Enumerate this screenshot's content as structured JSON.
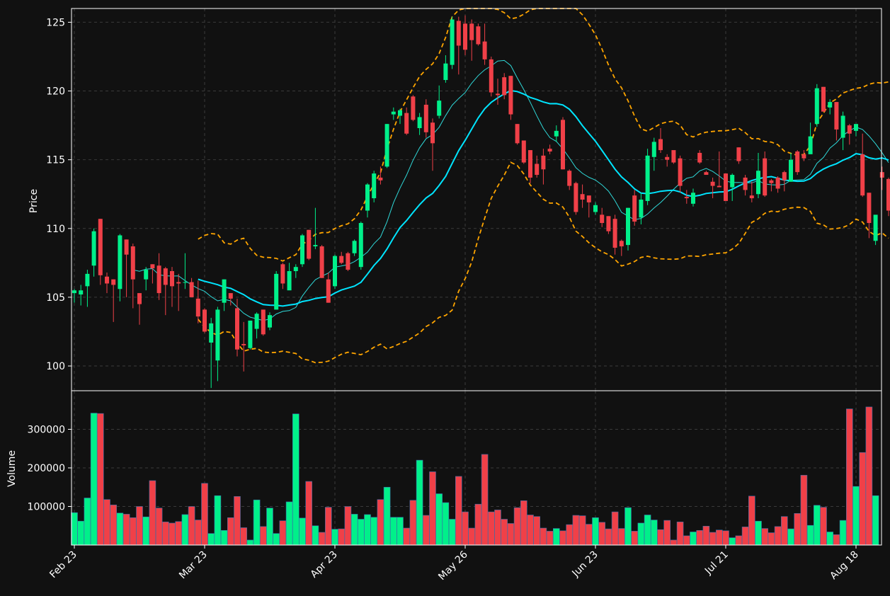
{
  "chart_data": [
    {
      "type": "candlestick",
      "ylabel": "Price",
      "ylim": [
        98.2,
        126.0
      ],
      "yticks": [
        "100",
        "105",
        "110",
        "115",
        "120",
        "125"
      ],
      "ytick_values": [
        100,
        105,
        110,
        115,
        120,
        125
      ],
      "xticks": [
        "Feb 23",
        "Mar 23",
        "Apr 23",
        "May 26",
        "Jun 23",
        "Jul 21",
        "Aug 18"
      ],
      "xtick_index": [
        0,
        20,
        40,
        60,
        80,
        100,
        120
      ],
      "colors": {
        "up": "#00f08a",
        "down": "#f04048",
        "ma_short": "#2fd8d8",
        "ma_long": "#00e5ff",
        "bands": "#ffa500"
      },
      "grid": true,
      "ohlc": [
        [
          105.3,
          105.6,
          104.6,
          105.5
        ],
        [
          105.2,
          105.9,
          104.4,
          105.5
        ],
        [
          105.8,
          107.0,
          104.3,
          106.7
        ],
        [
          107.3,
          110.0,
          106.5,
          109.8
        ],
        [
          110.7,
          110.7,
          105.9,
          106.6
        ],
        [
          106.5,
          106.8,
          105.3,
          106.0
        ],
        [
          106.3,
          106.3,
          103.2,
          105.9
        ],
        [
          105.6,
          109.6,
          104.7,
          109.5
        ],
        [
          109.2,
          109.2,
          105.0,
          108.1
        ],
        [
          108.7,
          108.9,
          104.2,
          106.3
        ],
        [
          105.3,
          105.3,
          103.0,
          104.5
        ],
        [
          106.3,
          107.2,
          105.5,
          107.0
        ],
        [
          107.4,
          107.4,
          106.0,
          107.1
        ],
        [
          107.3,
          108.2,
          104.8,
          105.3
        ],
        [
          107.1,
          107.2,
          103.7,
          105.9
        ],
        [
          106.9,
          107.2,
          104.3,
          105.8
        ],
        [
          106.1,
          106.7,
          104.0,
          106.0
        ],
        [
          106.1,
          108.2,
          105.6,
          106.1
        ],
        [
          106.1,
          106.4,
          105.2,
          105.0
        ],
        [
          104.9,
          106.2,
          103.1,
          103.6
        ],
        [
          104.1,
          104.2,
          102.4,
          102.5
        ],
        [
          101.7,
          103.5,
          98.4,
          103.1
        ],
        [
          100.4,
          104.3,
          98.9,
          104.1
        ],
        [
          104.6,
          106.3,
          104.0,
          106.3
        ],
        [
          105.3,
          105.3,
          104.4,
          104.9
        ],
        [
          104.2,
          104.9,
          100.7,
          101.2
        ],
        [
          101.6,
          103.2,
          99.6,
          101.5
        ],
        [
          101.3,
          103.3,
          101.2,
          103.3
        ],
        [
          102.7,
          103.9,
          102.0,
          103.8
        ],
        [
          104.1,
          104.1,
          102.2,
          102.3
        ],
        [
          102.8,
          103.9,
          102.6,
          103.7
        ],
        [
          104.1,
          106.9,
          104.1,
          106.7
        ],
        [
          107.4,
          107.5,
          105.6,
          106.0
        ],
        [
          105.5,
          107.5,
          105.6,
          106.9
        ],
        [
          106.9,
          107.4,
          106.4,
          107.2
        ],
        [
          107.4,
          109.6,
          107.2,
          109.5
        ],
        [
          109.9,
          109.9,
          107.7,
          107.8
        ],
        [
          108.7,
          111.5,
          108.5,
          108.8
        ],
        [
          108.7,
          108.8,
          106.4,
          106.4
        ],
        [
          106.3,
          106.8,
          104.6,
          104.6
        ],
        [
          105.8,
          108.1,
          105.6,
          108.0
        ],
        [
          108.0,
          108.3,
          107.4,
          107.5
        ],
        [
          108.2,
          108.3,
          106.9,
          107.0
        ],
        [
          108.2,
          109.2,
          108.0,
          109.1
        ],
        [
          107.2,
          110.5,
          107.0,
          110.4
        ],
        [
          111.3,
          113.3,
          110.8,
          113.2
        ],
        [
          112.2,
          114.2,
          111.9,
          114.0
        ],
        [
          113.7,
          114.5,
          113.2,
          113.5
        ],
        [
          114.5,
          117.6,
          114.4,
          117.6
        ],
        [
          118.3,
          118.8,
          117.9,
          118.5
        ],
        [
          118.2,
          118.7,
          117.6,
          118.6
        ],
        [
          118.4,
          118.8,
          116.8,
          116.9
        ],
        [
          119.6,
          119.7,
          117.8,
          117.9
        ],
        [
          117.3,
          118.4,
          116.8,
          118.1
        ],
        [
          119.0,
          119.4,
          116.6,
          117.0
        ],
        [
          117.7,
          118.0,
          114.2,
          116.2
        ],
        [
          118.2,
          120.4,
          118.0,
          119.3
        ],
        [
          120.8,
          122.6,
          120.6,
          122.0
        ],
        [
          121.9,
          125.4,
          121.6,
          125.2
        ],
        [
          125.1,
          125.4,
          121.2,
          123.3
        ],
        [
          124.9,
          125.5,
          122.6,
          123.0
        ],
        [
          124.9,
          125.2,
          122.2,
          123.7
        ],
        [
          124.7,
          124.9,
          123.3,
          123.4
        ],
        [
          123.6,
          124.9,
          121.9,
          122.3
        ],
        [
          122.3,
          122.5,
          119.6,
          119.9
        ],
        [
          119.8,
          120.9,
          119.0,
          119.7
        ],
        [
          121.0,
          121.3,
          119.4,
          119.7
        ],
        [
          121.1,
          121.1,
          117.9,
          118.3
        ],
        [
          117.6,
          117.6,
          116.1,
          116.2
        ],
        [
          116.4,
          116.4,
          114.7,
          114.8
        ],
        [
          115.7,
          115.7,
          113.3,
          113.7
        ],
        [
          114.7,
          115.3,
          113.7,
          113.9
        ],
        [
          115.3,
          115.8,
          113.2,
          114.3
        ],
        [
          115.8,
          116.1,
          115.4,
          115.6
        ],
        [
          116.7,
          117.5,
          116.3,
          117.1
        ],
        [
          117.9,
          118.1,
          114.3,
          114.3
        ],
        [
          114.2,
          114.3,
          112.8,
          113.1
        ],
        [
          113.3,
          113.4,
          111.0,
          111.2
        ],
        [
          112.5,
          113.2,
          111.5,
          112.1
        ],
        [
          112.4,
          112.4,
          110.8,
          111.9
        ],
        [
          111.2,
          111.9,
          111.0,
          111.7
        ],
        [
          111.0,
          111.5,
          110.1,
          110.4
        ],
        [
          110.9,
          110.9,
          109.6,
          109.8
        ],
        [
          110.7,
          111.0,
          108.1,
          108.6
        ],
        [
          109.1,
          109.2,
          108.0,
          108.7
        ],
        [
          108.8,
          111.5,
          108.4,
          111.5
        ],
        [
          112.4,
          112.8,
          110.2,
          110.5
        ],
        [
          110.8,
          112.6,
          110.3,
          112.1
        ],
        [
          112.0,
          115.8,
          111.7,
          115.3
        ],
        [
          115.2,
          116.6,
          114.2,
          116.3
        ],
        [
          116.5,
          117.3,
          115.5,
          115.7
        ],
        [
          115.2,
          115.4,
          114.5,
          115.0
        ],
        [
          115.7,
          115.6,
          114.7,
          114.8
        ],
        [
          115.1,
          115.3,
          112.6,
          113.1
        ],
        [
          112.3,
          112.8,
          111.8,
          112.2
        ],
        [
          111.8,
          112.9,
          111.6,
          112.6
        ],
        [
          115.5,
          115.7,
          114.7,
          114.8
        ],
        [
          114.1,
          114.2,
          114.0,
          113.9
        ],
        [
          113.4,
          113.7,
          112.2,
          113.1
        ],
        [
          113.1,
          115.6,
          113.0,
          113.0
        ],
        [
          114.0,
          114.0,
          112.4,
          112.0
        ],
        [
          113.0,
          114.0,
          112.0,
          113.9
        ],
        [
          115.9,
          115.9,
          114.7,
          114.9
        ],
        [
          113.7,
          113.9,
          112.4,
          112.8
        ],
        [
          112.4,
          113.4,
          111.9,
          112.2
        ],
        [
          112.5,
          115.5,
          112.2,
          114.2
        ],
        [
          115.1,
          115.6,
          112.3,
          112.4
        ],
        [
          113.5,
          113.6,
          112.7,
          113.3
        ],
        [
          113.7,
          113.8,
          112.6,
          112.9
        ],
        [
          114.1,
          114.2,
          112.7,
          113.5
        ],
        [
          113.4,
          115.5,
          113.4,
          115.0
        ],
        [
          115.6,
          115.7,
          113.9,
          114.1
        ],
        [
          115.4,
          115.7,
          114.9,
          115.1
        ],
        [
          115.4,
          117.7,
          115.6,
          116.7
        ],
        [
          117.6,
          120.5,
          117.4,
          120.2
        ],
        [
          120.3,
          120.3,
          118.6,
          118.5
        ],
        [
          118.8,
          119.4,
          118.3,
          119.2
        ],
        [
          119.2,
          119.2,
          116.4,
          117.2
        ],
        [
          116.6,
          118.5,
          115.7,
          118.2
        ],
        [
          117.5,
          117.6,
          116.1,
          116.9
        ],
        [
          117.1,
          117.3,
          116.7,
          117.6
        ],
        [
          115.4,
          116.9,
          112.3,
          112.4
        ],
        [
          112.6,
          112.6,
          109.3,
          110.4
        ],
        [
          109.1,
          109.8,
          108.8,
          111.0
        ],
        [
          114.1,
          114.5,
          112.8,
          113.7
        ],
        [
          113.6,
          113.7,
          110.9,
          111.3
        ]
      ],
      "volume": [
        84000,
        62000,
        122000,
        342000,
        341000,
        118000,
        104000,
        83000,
        80000,
        71000,
        100000,
        73000,
        167000,
        96000,
        60000,
        57000,
        61000,
        79000,
        100000,
        65000,
        160000,
        30000,
        128000,
        38000,
        71000,
        126000,
        45000,
        13000,
        117000,
        48000,
        96000,
        30000,
        63000,
        112000,
        340000,
        70000,
        165000,
        50000,
        33000,
        98000,
        41000,
        42000,
        100000,
        80000,
        67000,
        79000,
        72000,
        118000,
        150000,
        72000,
        72000,
        44000,
        116000,
        220000,
        77000,
        190000,
        133000,
        110000,
        67000,
        178000,
        86000,
        44000,
        106000,
        235000,
        86000,
        91000,
        67000,
        56000,
        97000,
        115000,
        78000,
        74000,
        44000,
        36000,
        43000,
        37000,
        53000,
        77000,
        76000,
        54000,
        71000,
        59000,
        42000,
        86000,
        43000,
        97000,
        36000,
        57000,
        78000,
        65000,
        40000,
        64000,
        13000,
        60000,
        24000,
        34000,
        38000,
        49000,
        33000,
        39000,
        37000,
        19000,
        24000,
        47000,
        127000,
        62000,
        43000,
        32000,
        48000,
        74000,
        42000,
        82000,
        181000,
        51000,
        103000,
        98000,
        34000,
        27000,
        64000,
        353000,
        152000,
        240000,
        358000,
        128000
      ],
      "ylim_volume": [
        0,
        400000
      ]
    },
    {
      "type": "bar",
      "ylabel": "Volume",
      "yticks": [
        "100000",
        "200000",
        "300000"
      ],
      "ytick_values": [
        100000,
        200000,
        300000
      ]
    }
  ]
}
